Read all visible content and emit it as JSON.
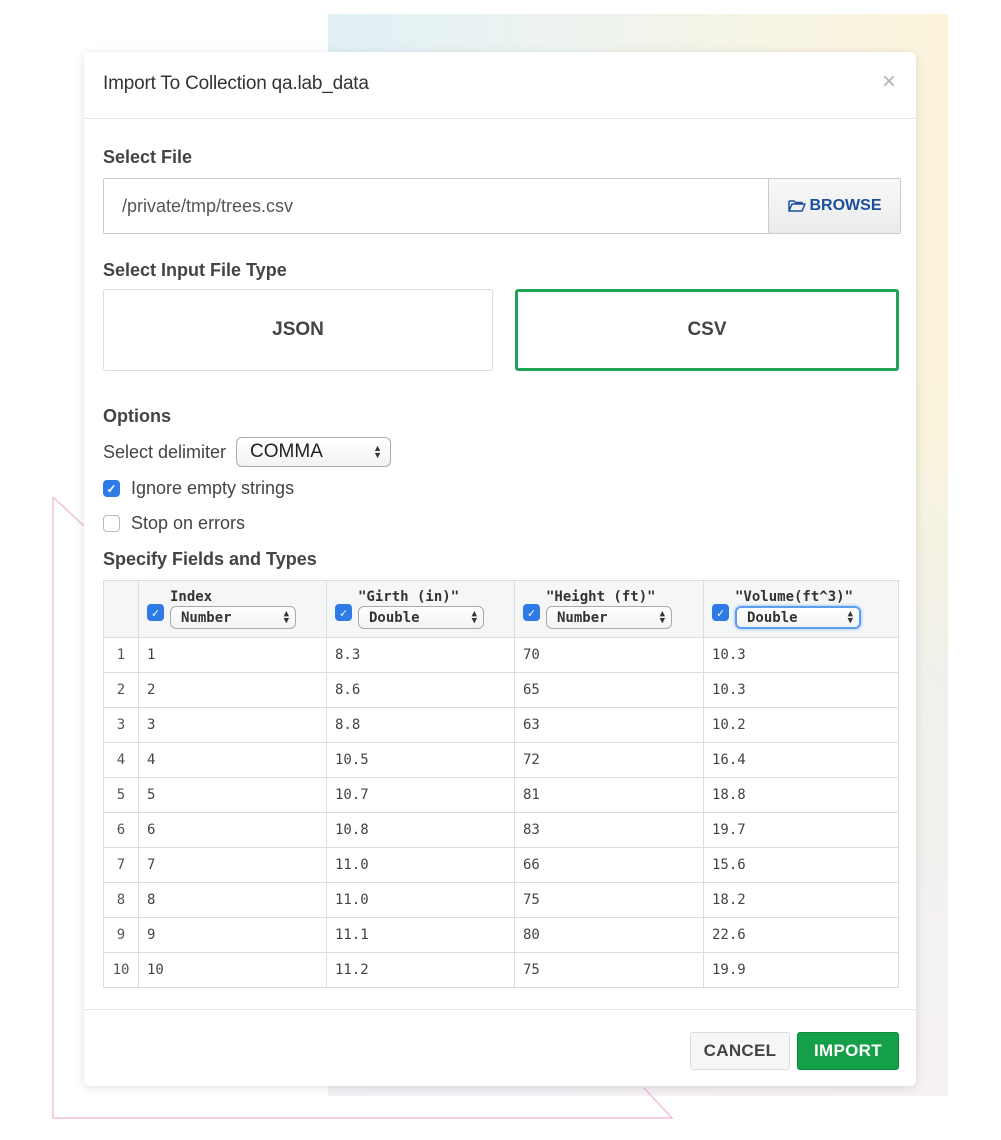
{
  "dialog": {
    "title": "Import To Collection qa.lab_data",
    "close_icon": "×"
  },
  "select_file": {
    "label": "Select File",
    "path_value": "/private/tmp/trees.csv",
    "browse_label": "BROWSE",
    "browse_icon": "folder-open-icon"
  },
  "file_type": {
    "label": "Select Input File Type",
    "options": [
      {
        "label": "JSON",
        "selected": false
      },
      {
        "label": "CSV",
        "selected": true
      }
    ]
  },
  "options": {
    "label": "Options",
    "delimiter_label": "Select delimiter",
    "delimiter_value": "COMMA",
    "ignore_empty_label": "Ignore empty strings",
    "ignore_empty_checked": true,
    "stop_on_errors_label": "Stop on errors",
    "stop_on_errors_checked": false
  },
  "fields": {
    "label": "Specify Fields and Types",
    "columns": [
      {
        "name": "Index",
        "type": "Number",
        "checked": true
      },
      {
        "name": "\"Girth (in)\"",
        "type": "Double",
        "checked": true
      },
      {
        "name": "\"Height (ft)\"",
        "type": "Number",
        "checked": true
      },
      {
        "name": "\"Volume(ft^3)\"",
        "type": "Double",
        "checked": true,
        "focused": true
      }
    ],
    "rows": [
      {
        "n": "1",
        "cells": [
          "1",
          "8.3",
          "70",
          "10.3"
        ]
      },
      {
        "n": "2",
        "cells": [
          "2",
          "8.6",
          "65",
          "10.3"
        ]
      },
      {
        "n": "3",
        "cells": [
          "3",
          "8.8",
          "63",
          "10.2"
        ]
      },
      {
        "n": "4",
        "cells": [
          "4",
          "10.5",
          "72",
          "16.4"
        ]
      },
      {
        "n": "5",
        "cells": [
          "5",
          "10.7",
          "81",
          "18.8"
        ]
      },
      {
        "n": "6",
        "cells": [
          "6",
          "10.8",
          "83",
          "19.7"
        ]
      },
      {
        "n": "7",
        "cells": [
          "7",
          "11.0",
          "66",
          "15.6"
        ]
      },
      {
        "n": "8",
        "cells": [
          "8",
          "11.0",
          "75",
          "18.2"
        ]
      },
      {
        "n": "9",
        "cells": [
          "9",
          "11.1",
          "80",
          "22.6"
        ]
      },
      {
        "n": "10",
        "cells": [
          "10",
          "11.2",
          "75",
          "19.9"
        ]
      }
    ]
  },
  "footer": {
    "cancel_label": "CANCEL",
    "import_label": "IMPORT"
  },
  "colors": {
    "accent_green": "#13a049",
    "selected_border": "#21a35a",
    "checkbox_blue": "#2f7be5",
    "browse_text": "#1a4f9c"
  }
}
